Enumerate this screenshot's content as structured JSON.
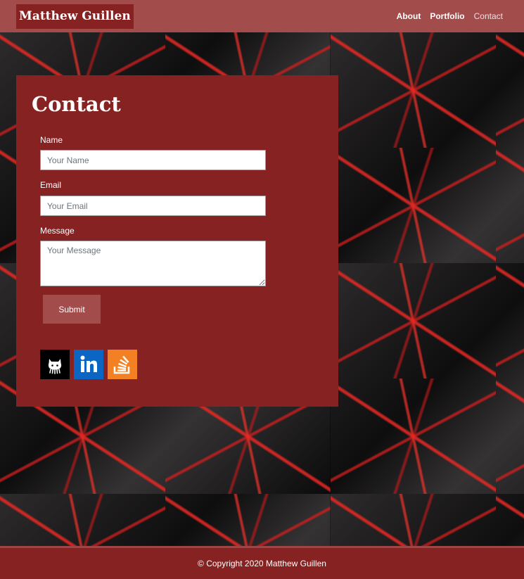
{
  "header": {
    "brand": "Matthew Guillen",
    "nav": [
      {
        "label": "About"
      },
      {
        "label": "Portfolio"
      },
      {
        "label": "Contact"
      }
    ]
  },
  "contact": {
    "title": "Contact",
    "name_label": "Name",
    "name_placeholder": "Your Name",
    "email_label": "Email",
    "email_placeholder": "Your Email",
    "message_label": "Message",
    "message_placeholder": "Your Message",
    "submit_label": "Submit"
  },
  "social": [
    {
      "icon": "github-icon",
      "color": "#000000"
    },
    {
      "icon": "linkedin-icon",
      "color": "#0a66c2"
    },
    {
      "icon": "stackoverflow-icon",
      "color": "#f48024"
    }
  ],
  "footer": {
    "copyright": "© Copyright 2020 Matthew Guillen"
  },
  "colors": {
    "header_bg": "#a24c4c",
    "card_bg": "#862221",
    "accent_red": "#e62823"
  }
}
